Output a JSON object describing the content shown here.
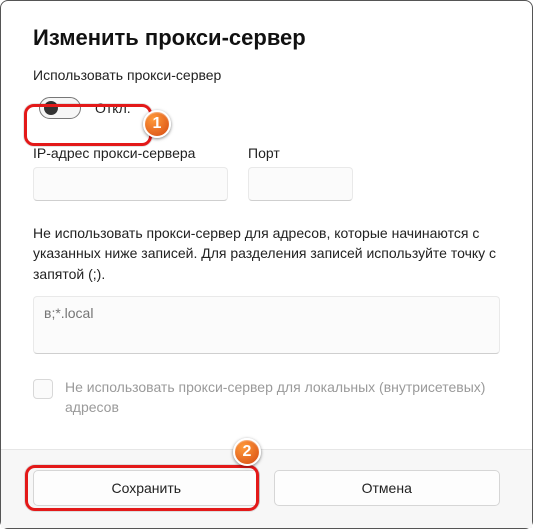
{
  "dialog": {
    "title": "Изменить прокси-сервер",
    "use_proxy_label": "Использовать прокси-сервер",
    "toggle_state_label": "Откл.",
    "ip_label": "IP-адрес прокси-сервера",
    "port_label": "Порт",
    "exceptions_hint": "Не использовать прокси-сервер для адресов, которые начинаются с указанных ниже записей. Для разделения записей используйте точку с запятой (;).",
    "exceptions_placeholder": "в;*.local",
    "local_checkbox_label": "Не использовать прокси-сервер для локальных (внутрисетевых) адресов",
    "save_label": "Сохранить",
    "cancel_label": "Отмена"
  },
  "annotations": {
    "step1": "1",
    "step2": "2"
  }
}
